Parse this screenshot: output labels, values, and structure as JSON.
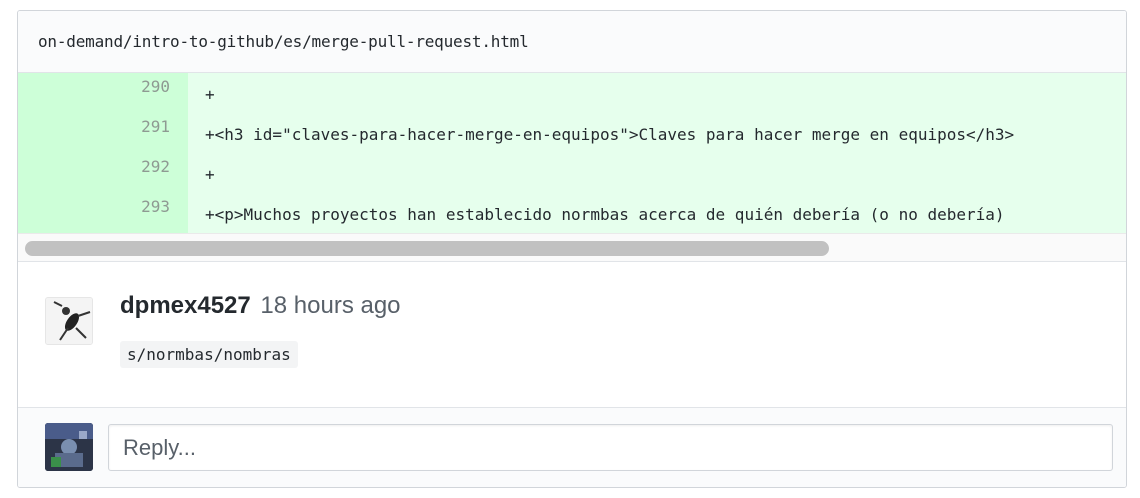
{
  "file": {
    "path": "on-demand/intro-to-github/es/merge-pull-request.html"
  },
  "diff": {
    "lines": [
      {
        "number": "290",
        "code": "+"
      },
      {
        "number": "291",
        "code": "+<h3 id=\"claves-para-hacer-merge-en-equipos\">Claves para hacer merge en equipos</h3>"
      },
      {
        "number": "292",
        "code": "+"
      },
      {
        "number": "293",
        "code": "+<p>Muchos proyectos han establecido normbas acerca de quién debería (o no debería)"
      }
    ],
    "added_line_color": "#e6ffed",
    "added_number_color": "#cdffd8"
  },
  "comment": {
    "author": "dpmex4527",
    "time": "18 hours ago",
    "body": "s/normbas/nombras",
    "avatar_icon": "user-avatar"
  },
  "reply": {
    "placeholder": "Reply...",
    "avatar_icon": "current-user-avatar"
  }
}
